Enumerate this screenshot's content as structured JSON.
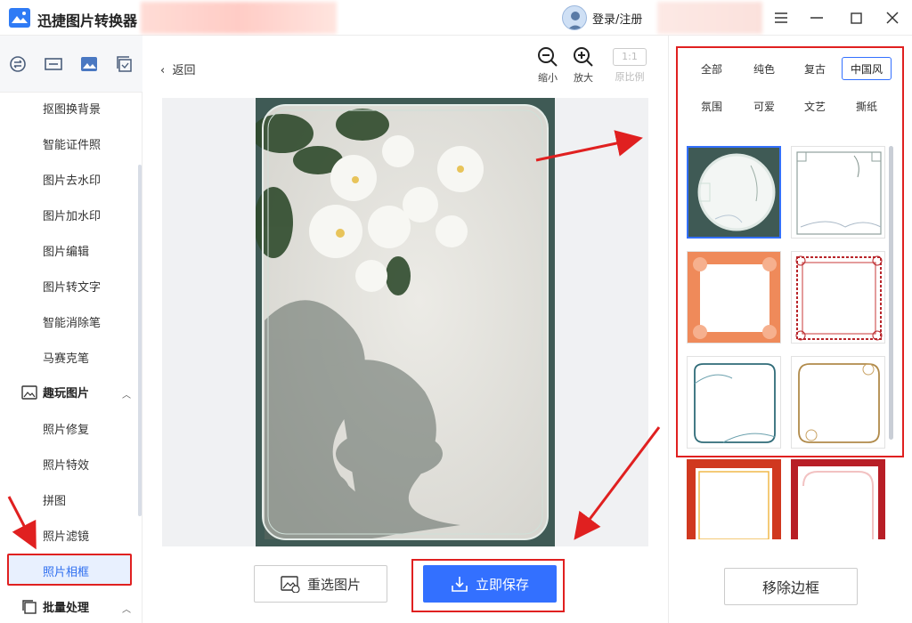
{
  "app": {
    "title": "迅捷图片转换器",
    "login": "登录/注册"
  },
  "sidebar": {
    "items": [
      "抠图换背景",
      "智能证件照",
      "图片去水印",
      "图片加水印",
      "图片编辑",
      "图片转文字",
      "智能消除笔",
      "马赛克笔"
    ],
    "group_fun": "趣玩图片",
    "fun_items": [
      "照片修复",
      "照片特效",
      "拼图",
      "照片滤镜",
      "照片相框"
    ],
    "group_batch": "批量处理"
  },
  "toolbar": {
    "back": "返回",
    "zoom_out": "缩小",
    "zoom_in": "放大",
    "ratio_icon": "1:1",
    "original": "原比例"
  },
  "actions": {
    "reselect": "重选图片",
    "save": "立即保存"
  },
  "frames_panel": {
    "categories": [
      "全部",
      "纯色",
      "复古",
      "中国风",
      "氛围",
      "可爱",
      "文艺",
      "撕纸"
    ],
    "selected_category": "中国风",
    "remove": "移除边框"
  },
  "colors": {
    "accent": "#3370ff",
    "highlight": "#e02020",
    "photo_frame": "#3f5a55"
  }
}
